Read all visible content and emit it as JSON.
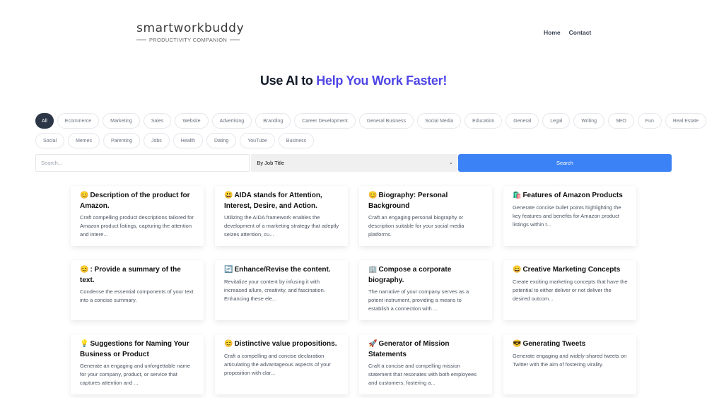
{
  "header": {
    "logo": {
      "text": "smartworkbuddy",
      "tagline": "PRODUCTIVITY COMPANION"
    },
    "nav": [
      {
        "label": "Home"
      },
      {
        "label": "Contact"
      }
    ]
  },
  "hero": {
    "prefix": "Use AI to ",
    "accent": "Help You Work Faster!",
    "accent_color": "#4f46e5"
  },
  "categories": {
    "active": "All",
    "row1": [
      "All",
      "Ecommerce",
      "Marketing",
      "Sales",
      "Website",
      "Advertising",
      "Branding",
      "Career Development",
      "General Business",
      "Social Media",
      "Education",
      "General",
      "Legal",
      "Writing",
      "SEO",
      "Fun",
      "Real Estate"
    ],
    "row2": [
      "Social",
      "Memes",
      "Parenting",
      "Jobs",
      "Health",
      "Dating",
      "YouTube",
      "Business"
    ]
  },
  "search": {
    "placeholder": "Search...",
    "value": "",
    "filter_selected": "By Job Title",
    "button_label": "Search",
    "button_color": "#3b82f6"
  },
  "cards": [
    {
      "icon": "😊",
      "icon_name": "smile-icon",
      "title": "Description of the product for Amazon.",
      "desc": "Craft compelling product descriptions tailored for Amazon product listings, capturing the attention and intere..."
    },
    {
      "icon": "😃",
      "icon_name": "grin-icon",
      "title": "AIDA stands for Attention, Interest, Desire, and Action.",
      "desc": "Utilizing the AIDA framework enables the development of a marketing strategy that adeptly seizes attention, cu..."
    },
    {
      "icon": "😊",
      "icon_name": "smile-icon",
      "title": "Biography: Personal Background",
      "desc": "Craft an engaging personal biography or description suitable for your social media platforms."
    },
    {
      "icon": "🛍️",
      "icon_name": "shopping-bags-icon",
      "title": "Features of Amazon Products",
      "desc": "Generate concise bullet points highlighting the key features and benefits for Amazon product listings within t..."
    },
    {
      "icon": "😊",
      "icon_name": "smile-icon",
      "title": ": Provide a summary of the text.",
      "desc": "Condense the essential components of your text into a concise summary."
    },
    {
      "icon": "🔄",
      "icon_name": "refresh-icon",
      "title": "Enhance/Revise the content.",
      "desc": "Revitalize your content by infusing it with increased allure, creativity, and fascination. Enhancing these ele..."
    },
    {
      "icon": "🏢",
      "icon_name": "office-building-icon",
      "title": "Compose a corporate biography.",
      "desc": "The narrative of your company serves as a potent instrument, providing a means to establish a connection with ..."
    },
    {
      "icon": "😄",
      "icon_name": "laugh-icon",
      "title": "Creative Marketing Concepts",
      "desc": "Create exciting marketing concepts that have the potential to either deliver or not deliver the desired outcom..."
    },
    {
      "icon": "💡",
      "icon_name": "lightbulb-icon",
      "title": "Suggestions for Naming Your Business or Product",
      "desc": "Generate an engaging and unforgettable name for your company, product, or service that captures attention and ..."
    },
    {
      "icon": "😊",
      "icon_name": "smile-icon",
      "title": "Distinctive value propositions.",
      "desc": "Craft a compelling and concise declaration articulating the advantageous aspects of your proposition with clar..."
    },
    {
      "icon": "🚀",
      "icon_name": "rocket-icon",
      "title": "Generator of Mission Statements",
      "desc": "Craft a concise and compelling mission statement that resonates with both employees and customers, fostering a..."
    },
    {
      "icon": "😎",
      "icon_name": "sunglasses-icon",
      "title": "Generating Tweets",
      "desc": "Generate engaging and widely-shared tweets on Twitter with the aim of fostering virality."
    }
  ]
}
